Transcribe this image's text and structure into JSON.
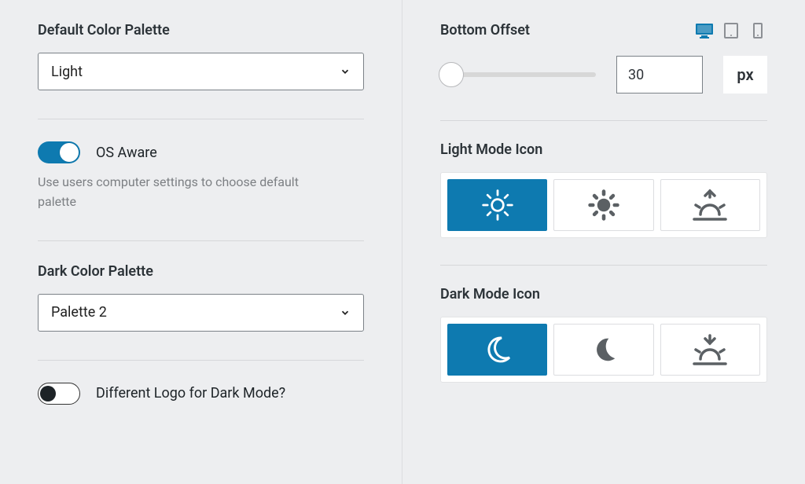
{
  "left": {
    "default_palette_label": "Default Color Palette",
    "default_palette_value": "Light",
    "os_aware_label": "OS Aware",
    "os_aware_help": "Use users computer settings to choose default palette",
    "dark_palette_label": "Dark Color Palette",
    "dark_palette_value": "Palette 2",
    "diff_logo_label": "Different Logo for Dark Mode?"
  },
  "right": {
    "bottom_offset_label": "Bottom Offset",
    "bottom_offset_value": "30",
    "bottom_offset_unit": "px",
    "light_icon_label": "Light Mode Icon",
    "dark_icon_label": "Dark Mode Icon"
  },
  "colors": {
    "accent": "#0e7ab0",
    "muted_icon": "#8c8f94"
  }
}
